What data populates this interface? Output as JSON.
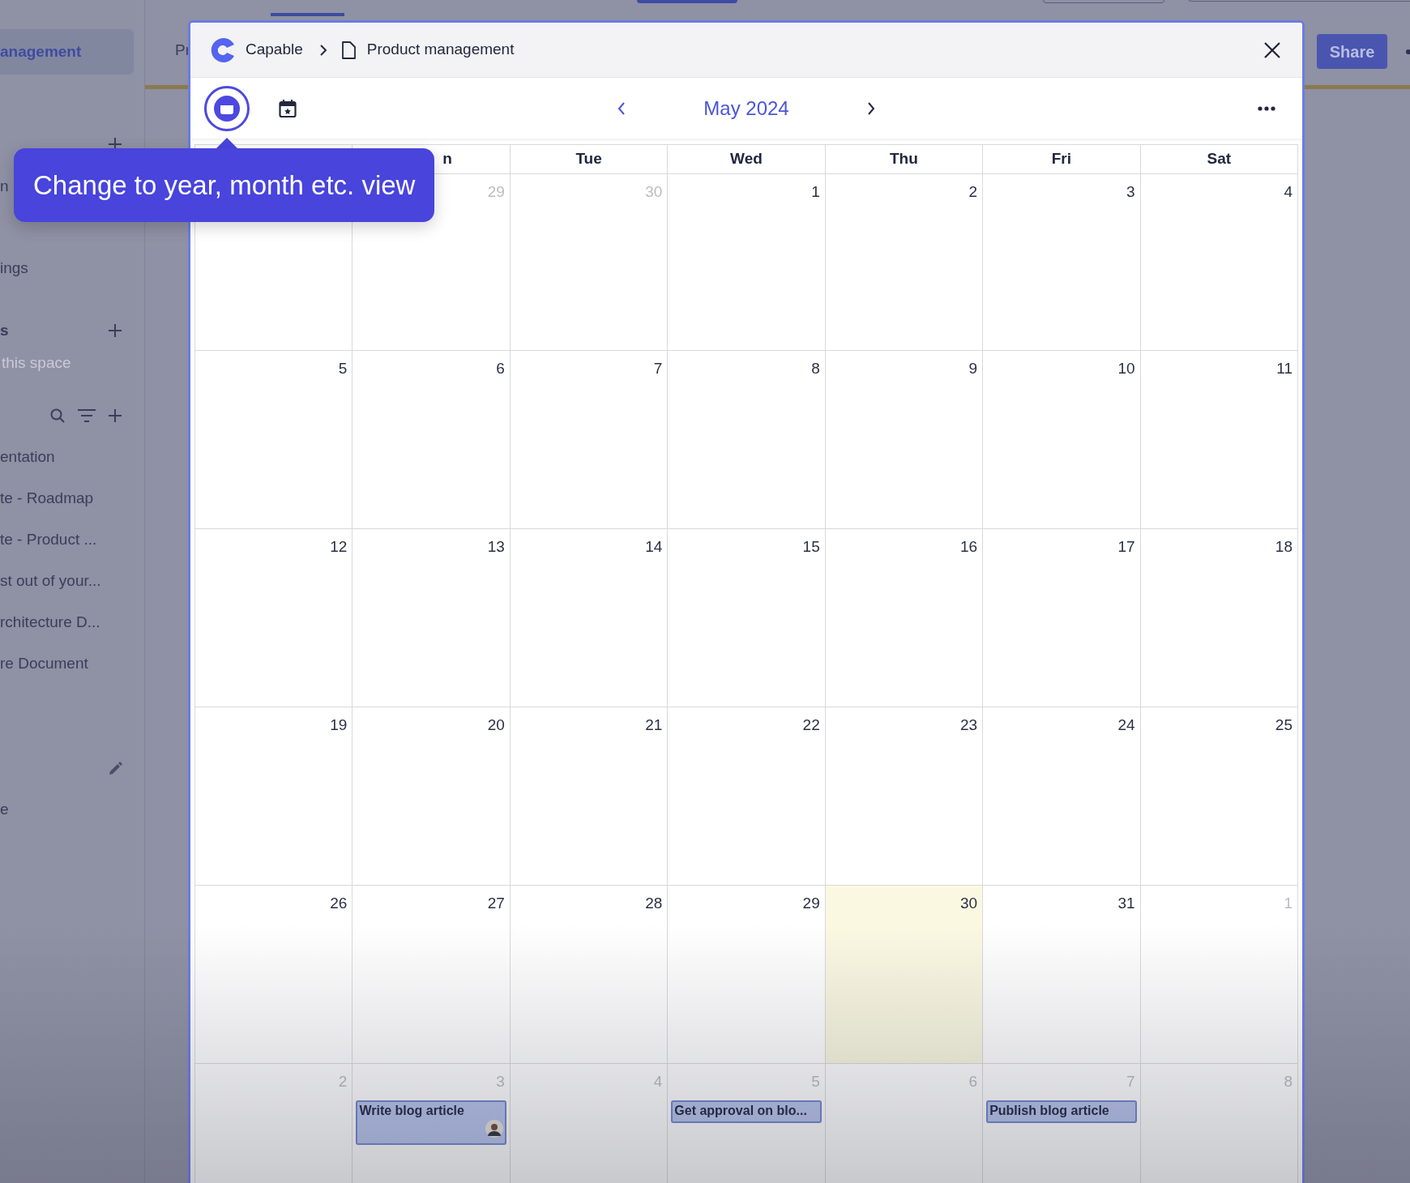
{
  "sidebar": {
    "items": [
      {
        "kind": "item",
        "label": "anagement",
        "selected": true
      },
      {
        "kind": "add"
      },
      {
        "kind": "item",
        "label": "n",
        "selected": false
      },
      {
        "kind": "item",
        "label": "ings",
        "selected": false
      },
      {
        "kind": "section",
        "label": "s"
      },
      {
        "kind": "hint",
        "label": "this space"
      },
      {
        "kind": "tools"
      },
      {
        "kind": "item",
        "label": "entation",
        "selected": false
      },
      {
        "kind": "item",
        "label": "te - Roadmap",
        "selected": false
      },
      {
        "kind": "item",
        "label": "te - Product ...",
        "selected": false
      },
      {
        "kind": "item",
        "label": "st out of your...",
        "selected": false
      },
      {
        "kind": "item",
        "label": "rchitecture D...",
        "selected": false
      },
      {
        "kind": "item",
        "label": "re Document",
        "selected": false
      },
      {
        "kind": "edit"
      },
      {
        "kind": "item",
        "label": "e",
        "selected": false
      }
    ]
  },
  "page": {
    "title": "Pr",
    "share_button": "Share"
  },
  "modal": {
    "breadcrumb": {
      "app": "Capable",
      "page": "Product management"
    },
    "month": "May 2024",
    "tooltip": "Change to year, month etc. view",
    "weekday_headers": [
      "n",
      "Tue",
      "Wed",
      "Thu",
      "Fri",
      "Sat"
    ],
    "weeks": [
      [
        {
          "today": false
        },
        {
          "day": "29",
          "muted": true,
          "today": false
        },
        {
          "day": "30",
          "muted": true,
          "today": false
        },
        {
          "day": "1",
          "muted": false,
          "today": false
        },
        {
          "day": "2",
          "muted": false,
          "today": false
        },
        {
          "day": "3",
          "muted": false,
          "today": false
        },
        {
          "day": "4",
          "muted": false,
          "today": false
        }
      ],
      [
        {
          "day": "5",
          "muted": false,
          "today": false
        },
        {
          "day": "6",
          "muted": false,
          "today": false
        },
        {
          "day": "7",
          "muted": false,
          "today": false
        },
        {
          "day": "8",
          "muted": false,
          "today": false
        },
        {
          "day": "9",
          "muted": false,
          "today": false
        },
        {
          "day": "10",
          "muted": false,
          "today": false
        },
        {
          "day": "11",
          "muted": false,
          "today": false
        }
      ],
      [
        {
          "day": "12",
          "muted": false,
          "today": false
        },
        {
          "day": "13",
          "muted": false,
          "today": false
        },
        {
          "day": "14",
          "muted": false,
          "today": false
        },
        {
          "day": "15",
          "muted": false,
          "today": false
        },
        {
          "day": "16",
          "muted": false,
          "today": false
        },
        {
          "day": "17",
          "muted": false,
          "today": false
        },
        {
          "day": "18",
          "muted": false,
          "today": false
        }
      ],
      [
        {
          "day": "19",
          "muted": false,
          "today": false
        },
        {
          "day": "20",
          "muted": false,
          "today": false
        },
        {
          "day": "21",
          "muted": false,
          "today": false
        },
        {
          "day": "22",
          "muted": false,
          "today": false
        },
        {
          "day": "23",
          "muted": false,
          "today": false
        },
        {
          "day": "24",
          "muted": false,
          "today": false
        },
        {
          "day": "25",
          "muted": false,
          "today": false
        }
      ],
      [
        {
          "day": "26",
          "muted": false,
          "today": false
        },
        {
          "day": "27",
          "muted": false,
          "today": false
        },
        {
          "day": "28",
          "muted": false,
          "today": false
        },
        {
          "day": "29",
          "muted": false,
          "today": false
        },
        {
          "day": "30",
          "muted": false,
          "today": true
        },
        {
          "day": "31",
          "muted": false,
          "today": false
        },
        {
          "day": "1",
          "muted": true,
          "today": false
        }
      ],
      [
        {
          "day": "2",
          "muted": true,
          "today": false
        },
        {
          "day": "3",
          "muted": true,
          "today": false,
          "events": [
            {
              "title": "Write blog article",
              "avatar": true
            }
          ]
        },
        {
          "day": "4",
          "muted": true,
          "today": false
        },
        {
          "day": "5",
          "muted": true,
          "today": false,
          "events": [
            {
              "title": "Get approval on blo...",
              "avatar": false
            }
          ]
        },
        {
          "day": "6",
          "muted": true,
          "today": false
        },
        {
          "day": "7",
          "muted": true,
          "today": false,
          "events": [
            {
              "title": "Publish blog article",
              "avatar": false
            }
          ]
        },
        {
          "day": "8",
          "muted": true,
          "today": false
        }
      ]
    ]
  }
}
